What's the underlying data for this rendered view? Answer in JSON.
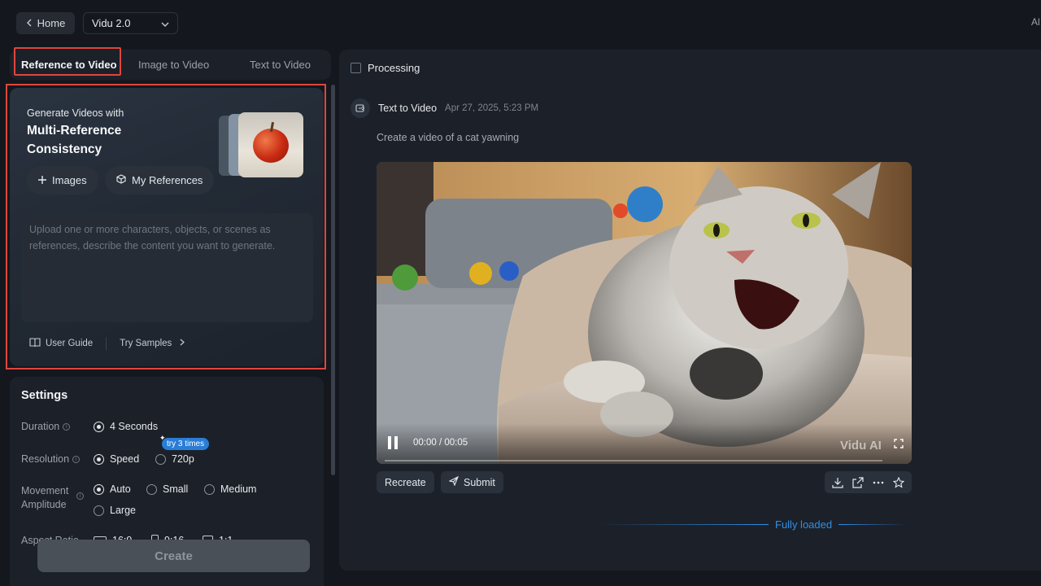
{
  "header": {
    "home_label": "Home",
    "model_value": "Vidu 2.0",
    "right_partial_text": "Al"
  },
  "tabs": [
    {
      "label": "Reference to Video",
      "active": true
    },
    {
      "label": "Image to Video",
      "active": false
    },
    {
      "label": "Text to Video",
      "active": false
    }
  ],
  "reference_card": {
    "subtitle": "Generate Videos with",
    "title": "Multi-Reference Consistency",
    "images_button": "Images",
    "my_references_button": "My References",
    "prompt_placeholder": "Upload one or more characters, objects, or scenes as references, describe the content you want to generate.",
    "user_guide": "User Guide",
    "try_samples": "Try Samples"
  },
  "settings": {
    "title": "Settings",
    "duration": {
      "label": "Duration",
      "options": [
        "4 Seconds"
      ],
      "selected": "4 Seconds"
    },
    "resolution": {
      "label": "Resolution",
      "options": [
        "Speed",
        "720p"
      ],
      "selected": "Speed",
      "badge": "try 3 times"
    },
    "movement": {
      "label_line1": "Movement",
      "label_line2": "Amplitude",
      "options": [
        "Auto",
        "Small",
        "Medium",
        "Large"
      ],
      "selected": "Auto"
    },
    "aspect_ratio": {
      "label": "Aspect Ratio",
      "options": [
        "16:9",
        "9:16",
        "1:1"
      ]
    },
    "create_label": "Create"
  },
  "results": {
    "processing_label": "Processing",
    "task": {
      "type": "Text to Video",
      "date": "Apr 27, 2025, 5:23 PM",
      "prompt": "Create a video of a cat yawning"
    },
    "video": {
      "current_time": "00:00",
      "separator": "/",
      "duration": "00:05",
      "progress": 0.0,
      "watermark": "Vidu AI"
    },
    "recreate_label": "Recreate",
    "submit_label": "Submit",
    "fully_loaded": "Fully loaded"
  },
  "colors": {
    "accent_blue": "#2f8fe8",
    "highlight_red": "#e0463c",
    "panel": "#1c2129",
    "background": "#14181e"
  }
}
